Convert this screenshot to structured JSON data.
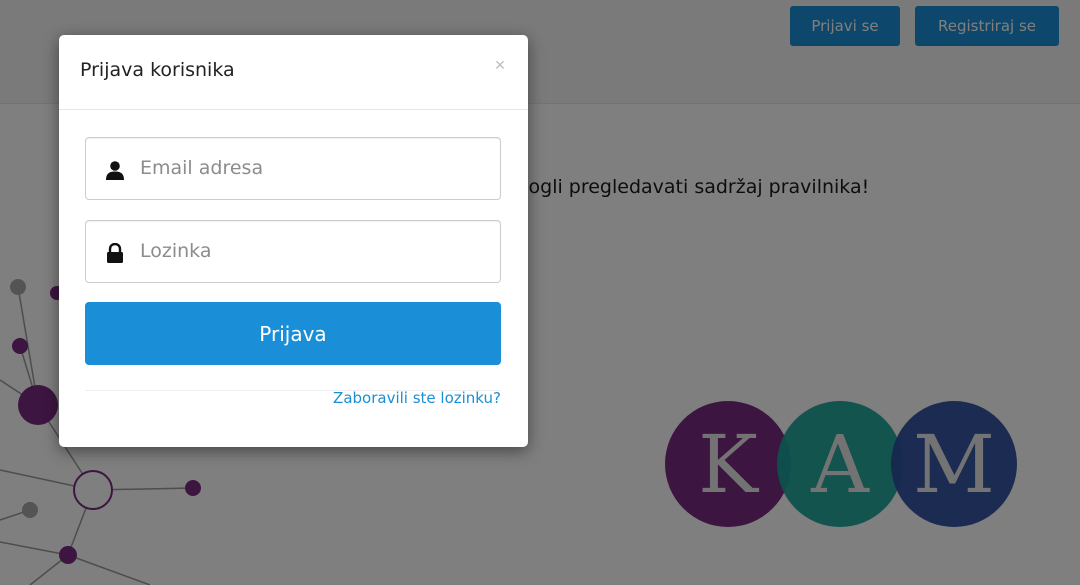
{
  "header": {
    "login_label": "Prijavi se",
    "register_label": "Registriraj se"
  },
  "page": {
    "notice_text": "mogli pregledavati sadržaj pravilnika!"
  },
  "logo": {
    "letters": [
      "K",
      "A",
      "M"
    ],
    "colors": [
      "#7a2a83",
      "#1aa39a",
      "#2d4e9e"
    ]
  },
  "modal": {
    "title": "Prijava korisnika",
    "close_symbol": "×",
    "email_placeholder": "Email adresa",
    "password_placeholder": "Lozinka",
    "submit_label": "Prijava",
    "forgot_password_label": "Zaboravili ste lozinku?"
  },
  "icons": {
    "email": "user-icon",
    "password": "lock-icon",
    "close": "close-icon"
  },
  "colors": {
    "accent": "#1a8fd8",
    "backdrop": "rgba(0,0,0,0.5)"
  }
}
